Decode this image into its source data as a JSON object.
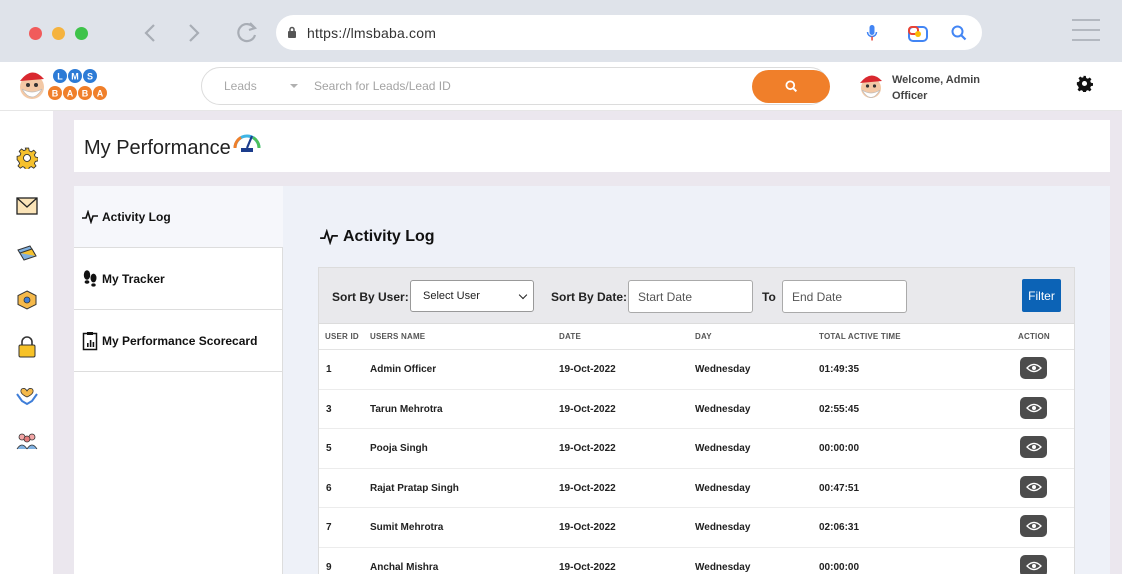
{
  "browser": {
    "url": "https://lmsbaba.com"
  },
  "header": {
    "logo_text": "LMS BABA",
    "search": {
      "category": "Leads",
      "placeholder": "Search for Leads/Lead ID"
    },
    "welcome_line1": "Welcome, Admin",
    "welcome_line2": "Officer"
  },
  "page": {
    "title": "My Performance"
  },
  "tabs": [
    {
      "label": "Activity Log",
      "icon": "activity-icon",
      "active": true
    },
    {
      "label": "My Tracker",
      "icon": "footsteps-icon",
      "active": false
    },
    {
      "label": "My Performance Scorecard",
      "icon": "scorecard-icon",
      "active": false
    }
  ],
  "activity": {
    "title": "Activity Log",
    "sort_user_label": "Sort By User:",
    "select_user": "Select User",
    "sort_date_label": "Sort By Date:",
    "start_date": "Start Date",
    "to_label": "To",
    "end_date": "End Date",
    "filter_label": "Filter",
    "columns": [
      "USER ID",
      "USERS NAME",
      "DATE",
      "DAY",
      "TOTAL ACTIVE TIME",
      "ACTION"
    ],
    "rows": [
      {
        "id": "1",
        "name": "Admin Officer",
        "date": "19-Oct-2022",
        "day": "Wednesday",
        "time": "01:49:35"
      },
      {
        "id": "3",
        "name": "Tarun Mehrotra",
        "date": "19-Oct-2022",
        "day": "Wednesday",
        "time": "02:55:45"
      },
      {
        "id": "5",
        "name": "Pooja Singh",
        "date": "19-Oct-2022",
        "day": "Wednesday",
        "time": "00:00:00"
      },
      {
        "id": "6",
        "name": "Rajat Pratap Singh",
        "date": "19-Oct-2022",
        "day": "Wednesday",
        "time": "00:47:51"
      },
      {
        "id": "7",
        "name": "Sumit Mehrotra",
        "date": "19-Oct-2022",
        "day": "Wednesday",
        "time": "02:06:31"
      },
      {
        "id": "9",
        "name": "Anchal Mishra",
        "date": "19-Oct-2022",
        "day": "Wednesday",
        "time": "00:00:00"
      }
    ]
  },
  "colors": {
    "accent_orange": "#f07f2a",
    "filter_blue": "#0c63b6"
  }
}
